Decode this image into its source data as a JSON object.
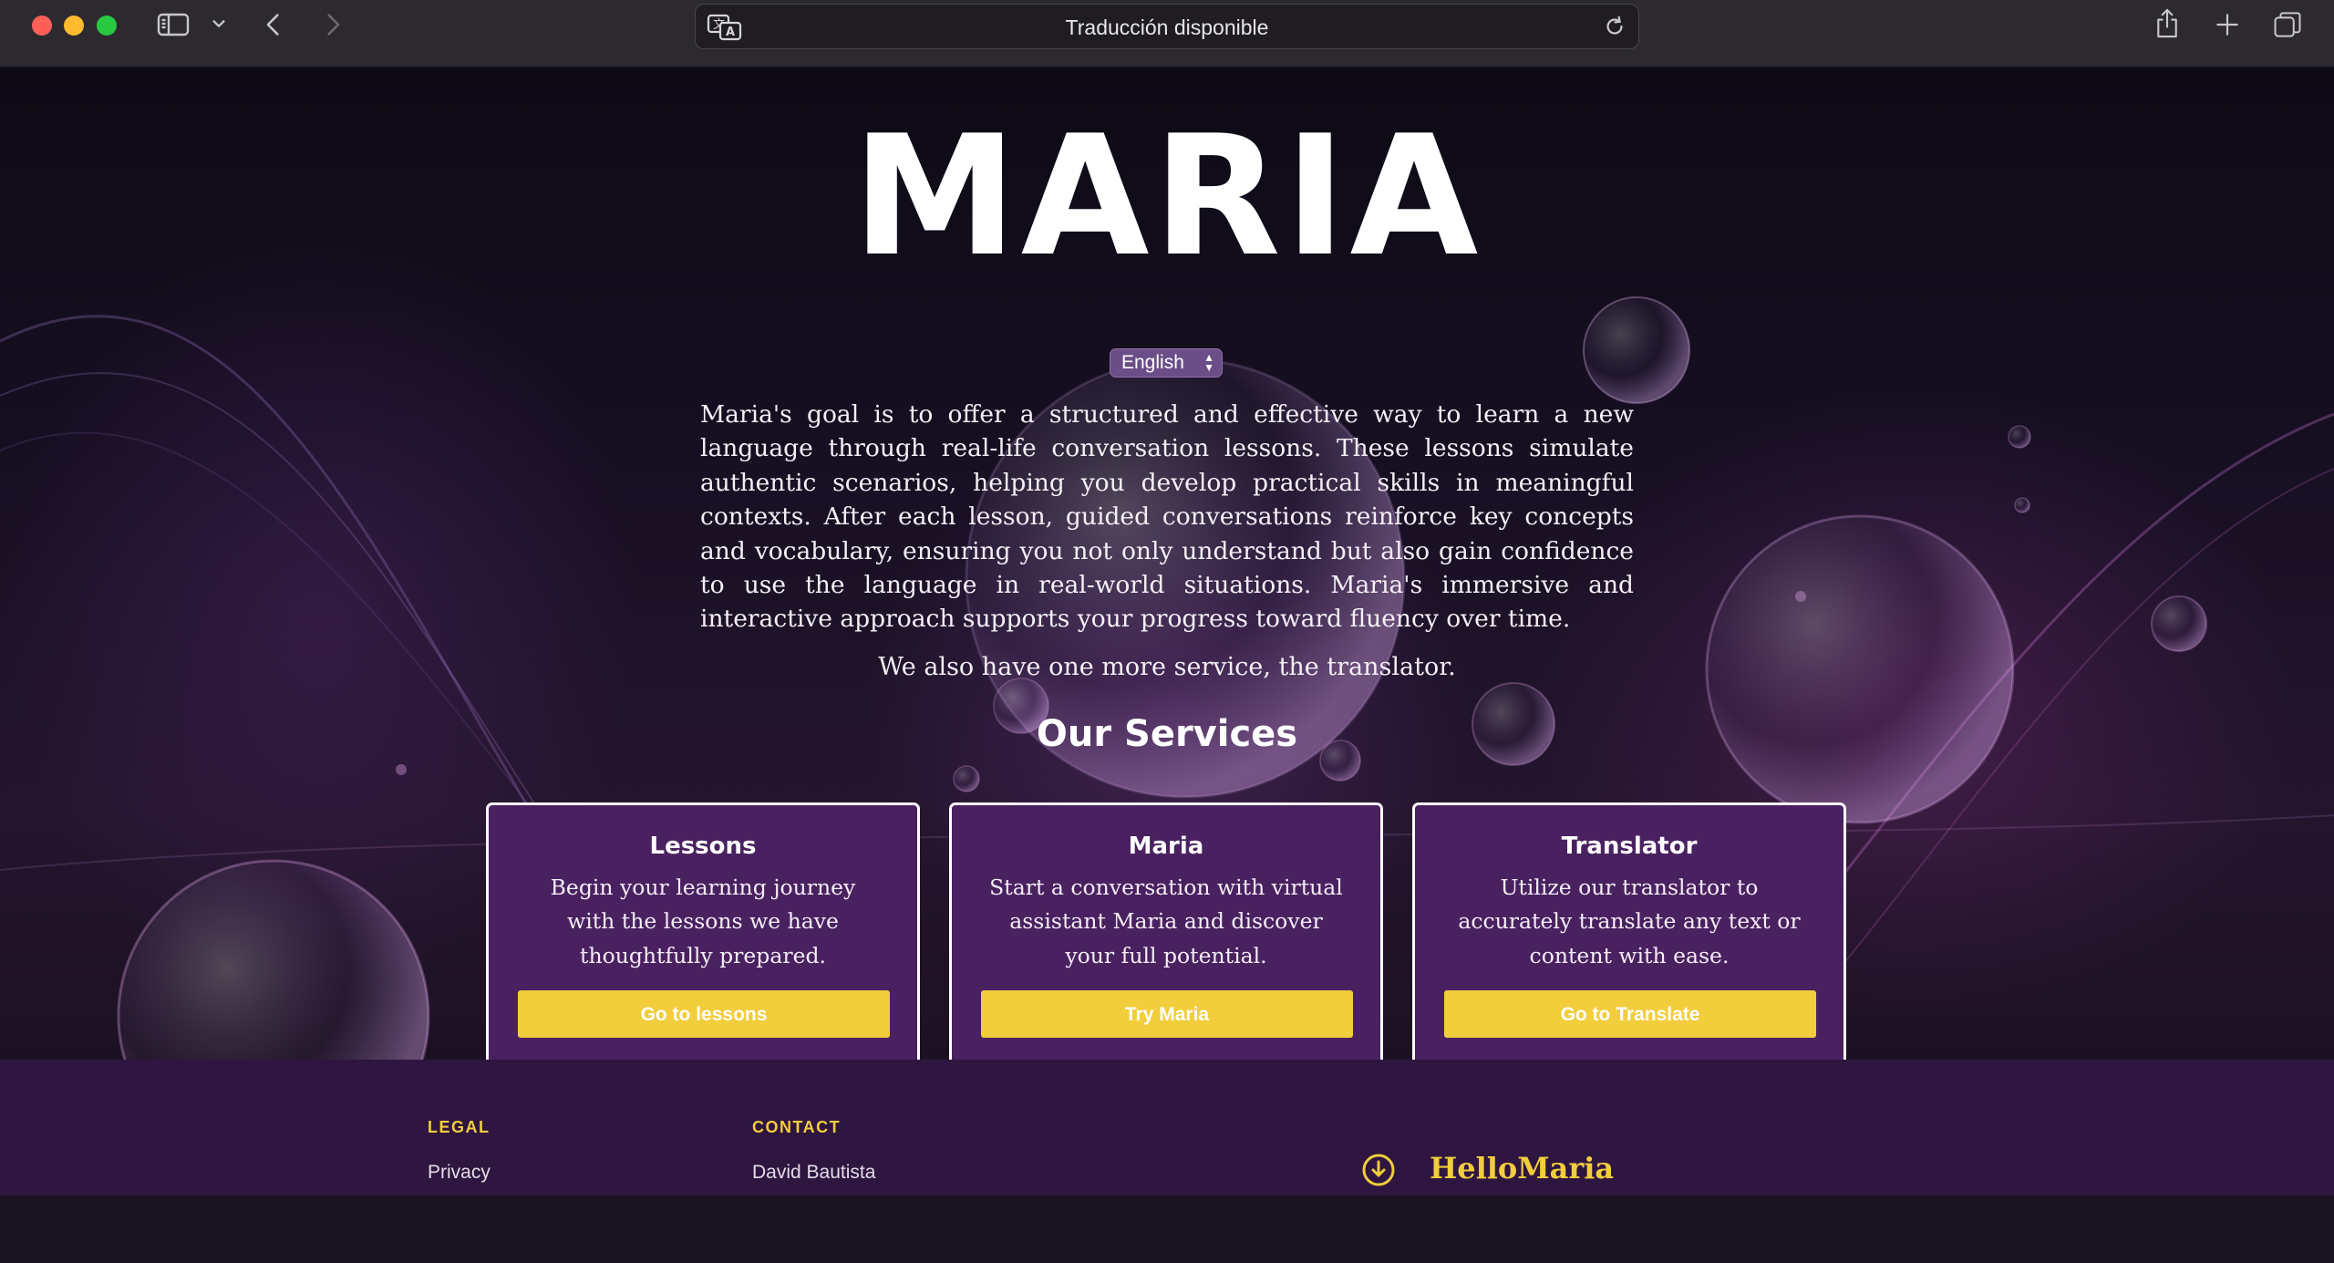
{
  "browser": {
    "address_text": "Traducción disponible"
  },
  "hero": {
    "title": "MARIA",
    "language": "English",
    "intro": "Maria's goal is to offer a structured and effective way to learn a new language through real-life conversation lessons. These lessons simulate authentic scenarios, helping you develop practical skills in meaningful contexts. After each lesson, guided conversations reinforce key concepts and vocabulary, ensuring you not only understand but also gain confidence to use the language in real-world situations. Maria's immersive and interactive approach supports your progress toward fluency over time.",
    "extra": "We also have one more service, the translator.",
    "services_heading": "Our Services"
  },
  "services": [
    {
      "title": "Lessons",
      "text": "Begin your learning journey with the lessons we have thoughtfully prepared.",
      "button": "Go to lessons"
    },
    {
      "title": "Maria",
      "text": "Start a conversation with virtual assistant Maria and discover your full potential.",
      "button": "Try Maria"
    },
    {
      "title": "Translator",
      "text": "Utilize our translator to accurately translate any text or content with ease.",
      "button": "Go to Translate"
    }
  ],
  "footer": {
    "legal_heading": "LEGAL",
    "legal_link": "Privacy",
    "contact_heading": "CONTACT",
    "contact_link": "David Bautista",
    "brand": "HelloMaria"
  },
  "colors": {
    "accent_yellow": "#f2cd3c",
    "card_purple": "#4a2160",
    "footer_purple": "#2f1640"
  },
  "icons": [
    "sidebar-toggle-icon",
    "chevron-down-icon",
    "back-arrow-icon",
    "forward-arrow-icon",
    "translate-icon",
    "reload-icon",
    "share-icon",
    "new-tab-icon",
    "tab-overview-icon",
    "download-circle-icon"
  ]
}
